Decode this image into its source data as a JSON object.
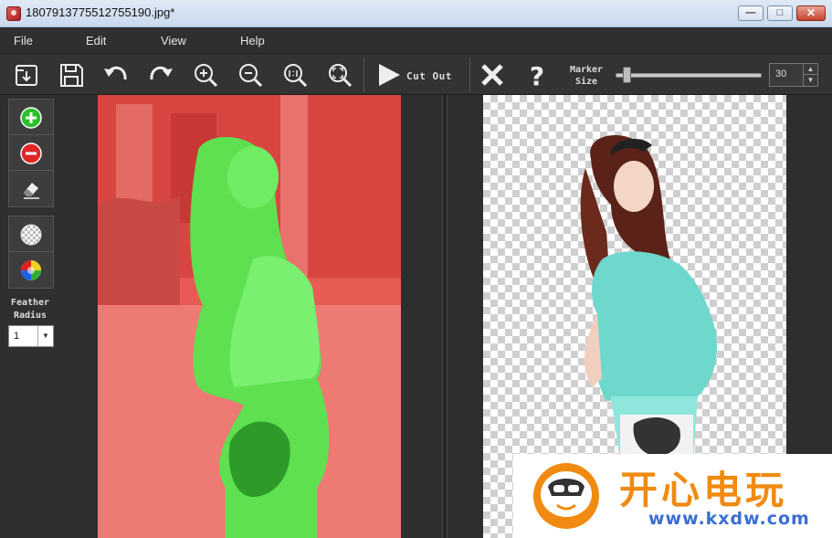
{
  "window": {
    "title": "1807913775512755190.jpg*",
    "minimize_glyph": "—",
    "maximize_glyph": "□",
    "close_glyph": "✕"
  },
  "menu": {
    "items": [
      "File",
      "Edit",
      "View",
      "Help"
    ]
  },
  "toolbar": {
    "icons": [
      "open-icon",
      "save-icon",
      "undo-icon",
      "redo-icon",
      "zoom-in-icon",
      "zoom-out-icon",
      "actual-size-icon",
      "fit-window-icon",
      "play-icon",
      "clear-icon",
      "help-icon"
    ],
    "cut_out_label": "Cut Out",
    "marker_size_label": "Marker Size",
    "marker_size_value": "30",
    "marker_slider_fraction": 0.05
  },
  "tools": {
    "icons": [
      "add-marker-icon",
      "remove-marker-icon",
      "eraser-icon",
      "transparent-background-icon",
      "color-background-icon"
    ],
    "feather_label": "Feather Radius",
    "feather_value": "1"
  },
  "colors": {
    "keep_marker": "#3cd23c",
    "remove_marker": "#ff3c3c",
    "panel_bg": "#2f2f2f"
  },
  "watermark": {
    "title": "开心电玩",
    "url": "www.kxdw.com"
  }
}
